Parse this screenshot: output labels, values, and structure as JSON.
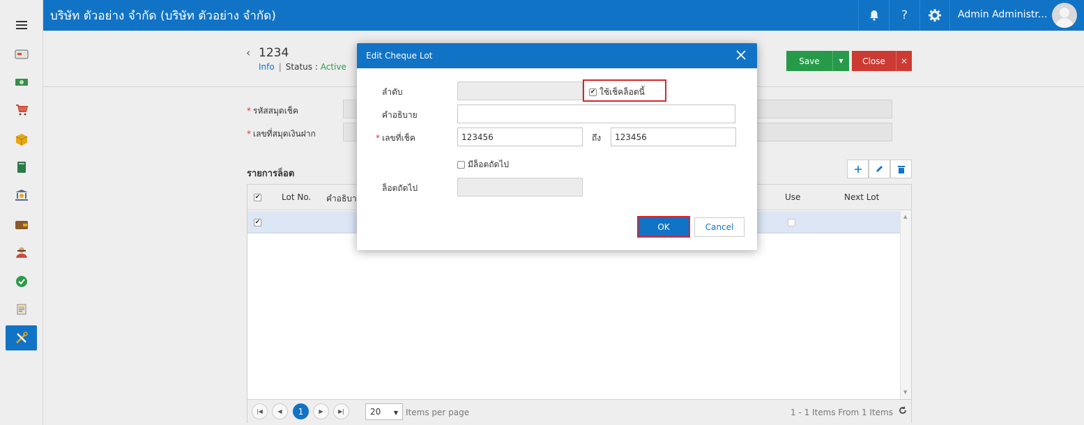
{
  "topbar": {
    "company": "บริษัท ตัวอย่าง จำกัด (บริษัท ตัวอย่าง จำกัด)",
    "user": "Admin Administr...",
    "icons": [
      "bell-icon",
      "help-icon",
      "settings-icon"
    ],
    "help_glyph": "?"
  },
  "sidebar": {
    "menu_icon": "hamburger-icon",
    "items": [
      "card-icon",
      "money-icon",
      "cart-icon",
      "box-icon",
      "book-icon",
      "bank-icon",
      "wallet-icon",
      "person-icon",
      "check-circle-icon",
      "document-icon",
      "tools-icon"
    ],
    "active": "tools-icon"
  },
  "header": {
    "back_glyph": "‹",
    "title": "1234",
    "info": "Info",
    "separator": "|",
    "status_label": "Status",
    "status_colon": ":",
    "status_value": "Active",
    "save": "Save",
    "close": "Close"
  },
  "form": {
    "book_code_label": "รหัสสมุดเช็ค",
    "deposit_no_label": "เลขที่สมุดเงินฝาก",
    "required_mark": "*"
  },
  "lot_list": {
    "title": "รายการล็อต",
    "columns": [
      "Lot No.",
      "คำอธิบาย",
      "Use",
      "Next Lot"
    ],
    "tools": [
      "add-icon",
      "edit-icon",
      "delete-icon"
    ]
  },
  "pager": {
    "current_page": "1",
    "page_size": "20",
    "items_per_page": "Items per page",
    "info": "1 - 1 Items From 1 Items"
  },
  "modal": {
    "title": "Edit Cheque Lot",
    "seq_label": "ลำดับ",
    "use_lot_label": "ใช้เช็คล็อตนี้",
    "use_lot_checked": true,
    "desc_label": "คำอธิบาย",
    "desc_value": "",
    "cheque_no_label": "เลขที่เช็ค",
    "cheque_from": "123456",
    "to_label": "ถึง",
    "cheque_to": "123456",
    "has_next_lot_label": "มีล็อตถัดไป",
    "has_next_lot_checked": false,
    "next_lot_label": "ล็อตถัดไป",
    "ok": "OK",
    "cancel": "Cancel",
    "highlight_color": "#d9242b"
  },
  "colors": {
    "primary": "#1173c6",
    "save": "#279a4a",
    "close": "#cb3a33",
    "active_status": "#2e9a4a"
  }
}
